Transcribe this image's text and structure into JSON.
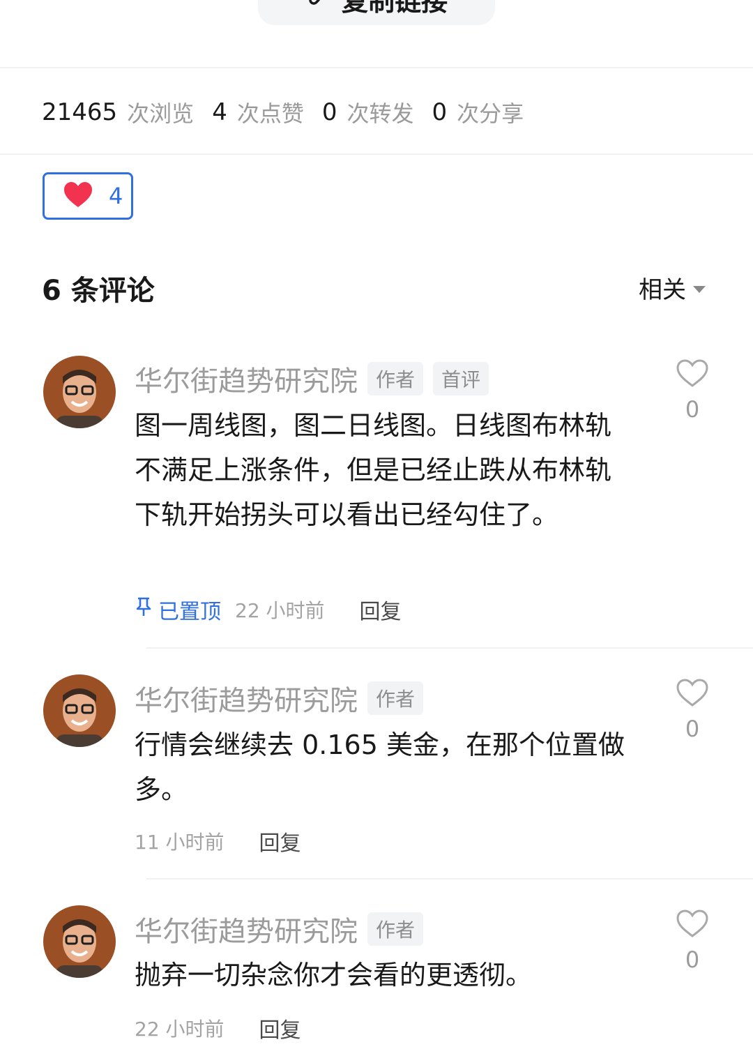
{
  "top_button": {
    "label": "复制链接",
    "icon": "link-icon"
  },
  "stats": [
    {
      "value": "21465",
      "label": "次浏览"
    },
    {
      "value": "4",
      "label": "次点赞"
    },
    {
      "value": "0",
      "label": "次转发"
    },
    {
      "value": "0",
      "label": "次分享"
    }
  ],
  "like_box": {
    "icon": "heart-icon",
    "count": "4",
    "color": "#2f6fdf",
    "heart_color": "#f2334f"
  },
  "comments_header": {
    "title": "6 条评论",
    "sort_label": "相关"
  },
  "comments": [
    {
      "author": "华尔街趋势研究院",
      "tags": [
        "作者",
        "首评"
      ],
      "text": "图一周线图，图二日线图。日线图布林轨不满足上涨条件，但是已经止跌从布林轨下轨开始拐头可以看出已经勾住了。",
      "pinned_label": "已置顶",
      "time": "22 小时前",
      "reply_label": "回复",
      "likes": "0"
    },
    {
      "author": "华尔街趋势研究院",
      "tags": [
        "作者"
      ],
      "text": "行情会继续去 0.165 美金，在那个位置做多。",
      "time": "11 小时前",
      "reply_label": "回复",
      "likes": "0"
    },
    {
      "author": "华尔街趋势研究院",
      "tags": [
        "作者"
      ],
      "text": "抛弃一切杂念你才会看的更透彻。",
      "time": "22 小时前",
      "reply_label": "回复",
      "likes": "0"
    }
  ]
}
